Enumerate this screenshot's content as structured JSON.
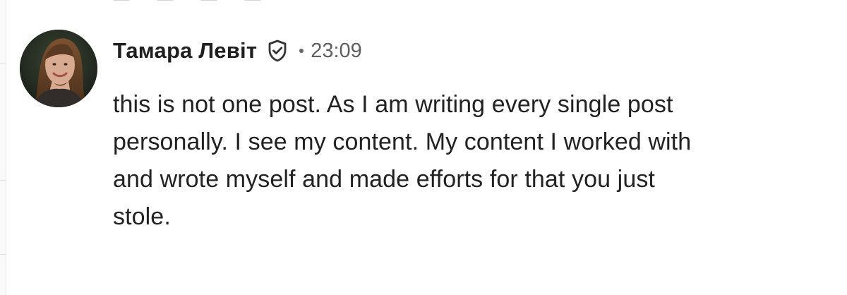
{
  "comment": {
    "author": {
      "name": "Тамара Левіт",
      "verified_icon": "shield-check-icon",
      "avatar_icon": "user-photo"
    },
    "timestamp": "23:09",
    "separator": "·",
    "message_lines": [
      "this is not one post. As I am writing every single post",
      "personally. I see my content. My content I worked with",
      "and wrote myself and made efforts for that you just",
      "stole."
    ]
  },
  "colors": {
    "name_text": "#1f1f1f",
    "body_text": "#222222",
    "meta_text": "#5f5f5f",
    "background": "#ffffff"
  }
}
